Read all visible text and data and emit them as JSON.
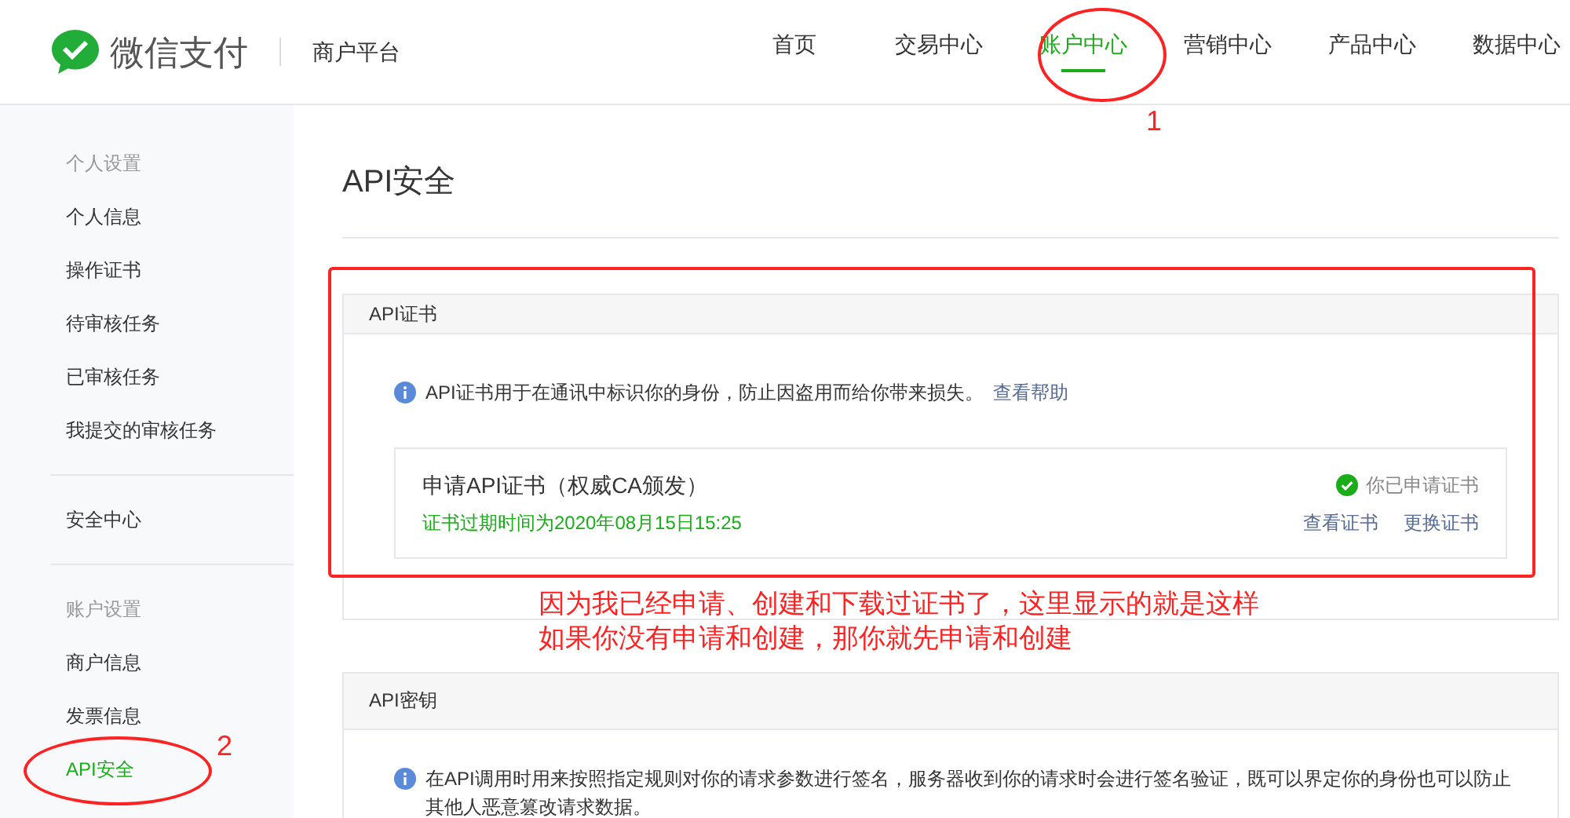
{
  "header": {
    "brand": "微信支付",
    "platform": "商户平台",
    "nav": [
      {
        "label": "首页",
        "selected": false
      },
      {
        "label": "交易中心",
        "selected": false
      },
      {
        "label": "账户中心",
        "selected": true
      },
      {
        "label": "营销中心",
        "selected": false
      },
      {
        "label": "产品中心",
        "selected": false
      },
      {
        "label": "数据中心",
        "selected": false
      }
    ]
  },
  "sidebar": {
    "groups": [
      {
        "title": "个人设置",
        "items": [
          {
            "label": "个人信息",
            "selected": false
          },
          {
            "label": "操作证书",
            "selected": false
          },
          {
            "label": "待审核任务",
            "selected": false
          },
          {
            "label": "已审核任务",
            "selected": false
          },
          {
            "label": "我提交的审核任务",
            "selected": false
          }
        ]
      },
      {
        "items": [
          {
            "label": "安全中心",
            "selected": false
          }
        ]
      },
      {
        "title": "账户设置",
        "items": [
          {
            "label": "商户信息",
            "selected": false
          },
          {
            "label": "发票信息",
            "selected": false
          },
          {
            "label": "API安全",
            "selected": true
          }
        ]
      }
    ]
  },
  "page_title": "API安全",
  "certificate_panel": {
    "title": "API证书",
    "info": "API证书用于在通讯中标识你的身份，防止因盗用而给你带来损失。",
    "help_link": "查看帮助",
    "card": {
      "title": "申请API证书（权威CA颁发）",
      "expiry": "证书过期时间为2020年08月15日15:25",
      "applied": true,
      "status": "你已申请证书",
      "actions": [
        "查看证书",
        "更换证书"
      ]
    }
  },
  "key_panel": {
    "title": "API密钥",
    "info": "在API调用时用来按照指定规则对你的请求参数进行签名，服务器收到你的请求时会进行签名验证，既可以界定你的身份也可以防止其他人恶意篡改请求数据。"
  },
  "annotations": {
    "markers": [
      "1",
      "2"
    ],
    "note": [
      "因为我已经申请、创建和下载过证书了，这里显示的就是这样",
      "如果你没有申请和创建，那你就先申请和创建"
    ]
  }
}
